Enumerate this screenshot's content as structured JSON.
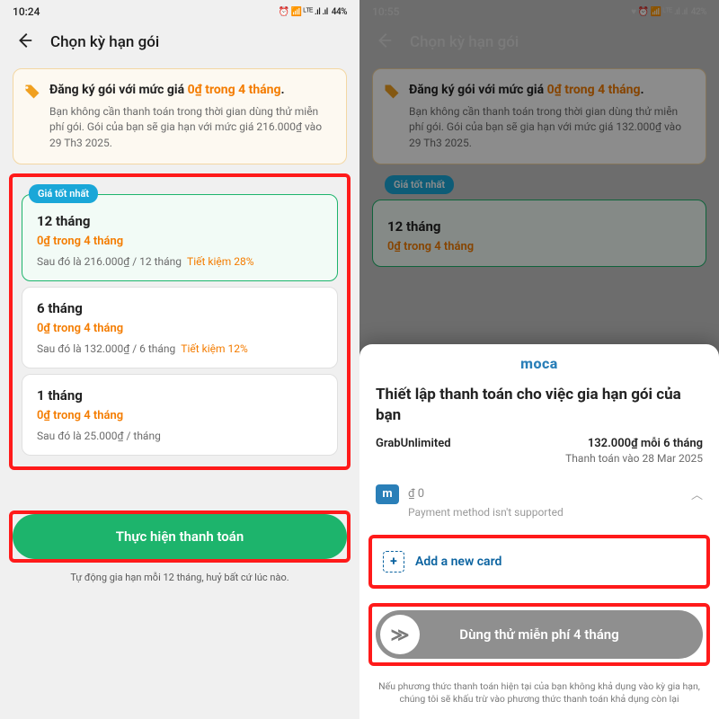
{
  "left": {
    "status": {
      "time": "10:24",
      "battery": "44%",
      "icons": "⏰ 📶 ᴸᵀᴱ .ıl .ıl"
    },
    "appbar": {
      "title": "Chọn kỳ hạn gói"
    },
    "banner": {
      "headline_pre": "Đăng ký gói với mức giá ",
      "headline_orange": "0₫ trong 4 tháng",
      "headline_post": ".",
      "sub": "Bạn không cần thanh toán trong thời gian dùng thử miễn phí gói. Gói của bạn sẽ gia hạn với mức giá 216.000₫ vào 29 Th3 2025."
    },
    "best_badge": "Giá tốt nhất",
    "plans": [
      {
        "name": "12 tháng",
        "trial": "0₫ trong 4 tháng",
        "after": "Sau đó là 216.000₫ / 12 tháng",
        "save": "Tiết kiệm 28%"
      },
      {
        "name": "6 tháng",
        "trial": "0₫ trong 4 tháng",
        "after": "Sau đó là 132.000₫ / 6 tháng",
        "save": "Tiết kiệm 12%"
      },
      {
        "name": "1 tháng",
        "trial": "0₫ trong 4 tháng",
        "after": "Sau đó là 25.000₫ / tháng",
        "save": ""
      }
    ],
    "cta": "Thực hiện thanh toán",
    "footnote": "Tự động gia hạn mỗi 12 tháng, huỷ bất cứ lúc nào."
  },
  "right": {
    "status": {
      "time": "10:55",
      "battery": "42%",
      "icons": "♥ ⏰ 📶 ᴸᵀᴱ .ıl .ıl"
    },
    "appbar": {
      "title": "Chọn kỳ hạn gói"
    },
    "banner": {
      "headline_pre": "Đăng ký gói với mức giá ",
      "headline_orange": "0₫ trong 4 tháng",
      "headline_post": ".",
      "sub": "Bạn không cần thanh toán trong thời gian dùng thử miễn phí gói. Gói của bạn sẽ gia hạn với mức giá 132.000₫ vào 29 Th3 2025."
    },
    "best_badge": "Giá tốt nhất",
    "under_plan": {
      "name": "12 tháng",
      "trial": "0₫ trong 4 tháng"
    },
    "sheet": {
      "brand": "moca",
      "title": "Thiết lập thanh toán cho việc gia hạn gói của bạn",
      "product": "GrabUnlimited",
      "price": "132.000₫ mỗi 6 tháng",
      "due": "Thanh toán vào 28 Mar 2025",
      "pm_balance": "₫ 0",
      "pm_note": "Payment method isn't supported",
      "add_card": "Add a new card",
      "swipe": "Dùng thử miễn phí 4 tháng",
      "disclaimer": "Nếu phương thức thanh toán hiện tại của bạn không khả dụng vào kỳ gia hạn, chúng tôi sẽ khấu trừ vào phương thức thanh toán khả dụng còn lại"
    }
  }
}
